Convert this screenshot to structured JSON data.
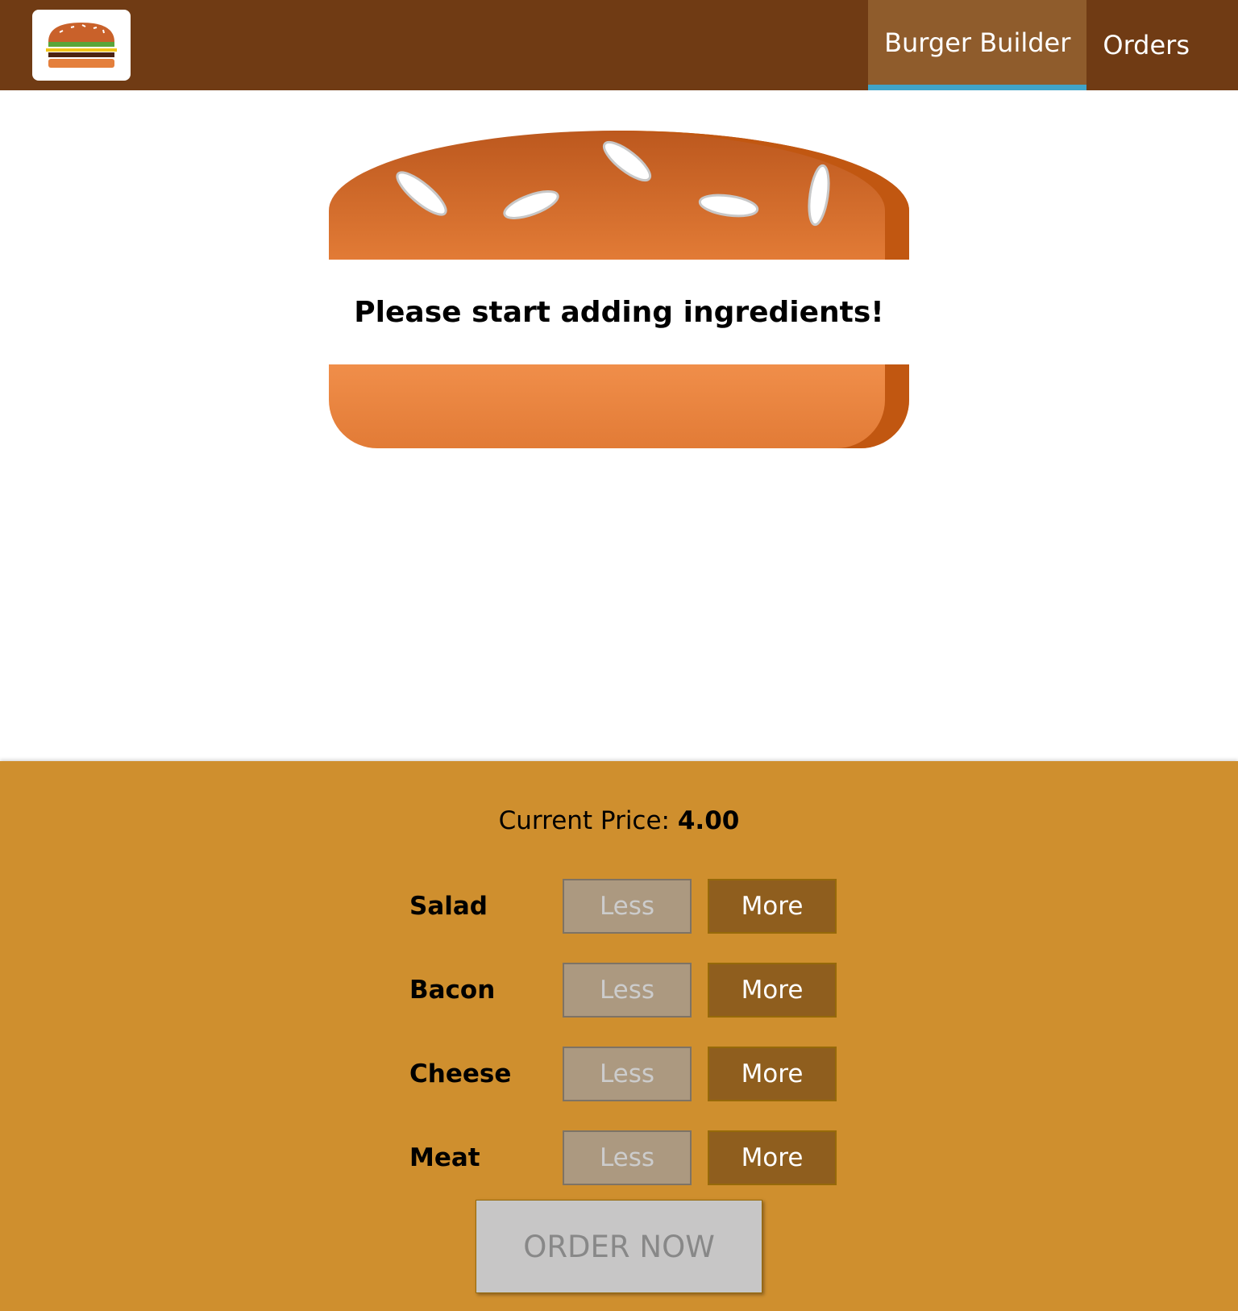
{
  "toolbar": {
    "logo_icon": "burger-logo-icon",
    "nav": [
      {
        "label": "Burger Builder",
        "active": true
      },
      {
        "label": "Orders",
        "active": false
      }
    ],
    "colors": {
      "background": "#703b14",
      "active_item": "#8f5c2c",
      "active_underline": "#40a4c8"
    }
  },
  "burger": {
    "message": "Please start adding ingredients!",
    "colors": {
      "bread_top": "#bc581e",
      "bread_bottom": "#e27b36",
      "seeds": "#ffffff"
    }
  },
  "controls": {
    "price_label": "Current Price: ",
    "price_value": "4.00",
    "ingredients": [
      {
        "label": "Salad",
        "less_label": "Less",
        "more_label": "More"
      },
      {
        "label": "Bacon",
        "less_label": "Less",
        "more_label": "More"
      },
      {
        "label": "Cheese",
        "less_label": "Less",
        "more_label": "More"
      },
      {
        "label": "Meat",
        "less_label": "Less",
        "more_label": "More"
      }
    ],
    "order_button": "ORDER NOW",
    "colors": {
      "panel": "#cf8f2e",
      "more_button": "#8f5e1e",
      "less_button_disabled": "#ac9980",
      "order_disabled": "#c7c6c6"
    }
  }
}
